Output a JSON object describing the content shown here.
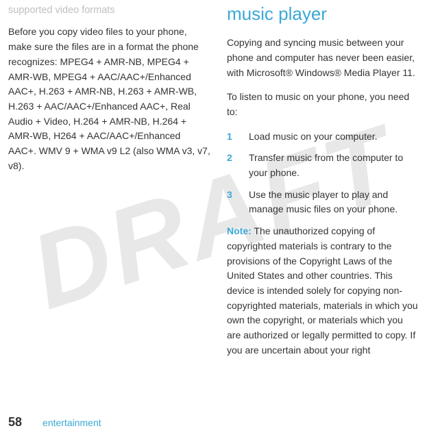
{
  "watermark": "DRAFT",
  "left": {
    "subheading": "supported video formats",
    "body": "Before you copy video files to your phone, make sure the files are in a format the phone recognizes: MPEG4 + AMR-NB, MPEG4 + AMR-WB, MPEG4 + AAC/AAC+/Enhanced AAC+, H.263 + AMR-NB, H.263 + AMR-WB, H.263 + AAC/AAC+/Enhanced AAC+, Real Audio + Video, H.264 + AMR-NB, H.264 + AMR-WB, H264 + AAC/AAC+/Enhanced AAC+. WMV 9 + WMA v9 L2 (also WMA v3, v7, v8)."
  },
  "right": {
    "heading": "music player",
    "intro": "Copying and syncing music between your phone and computer has never been easier, with Microsoft® Windows® Media Player 11.",
    "lead": "To listen to music on your phone, you need to:",
    "steps": [
      {
        "num": "1",
        "text": "Load music on your computer."
      },
      {
        "num": "2",
        "text": "Transfer music from the computer to your phone."
      },
      {
        "num": "3",
        "text": "Use the music player to play and manage music files on your phone."
      }
    ],
    "note_label": "Note:",
    "note_body": " The unauthorized copying of copyrighted materials is contrary to the provisions of the Copyright Laws of the United States and other countries. This device is intended solely for copying non-copyrighted materials, materials in which you own the copyright, or materials which you are authorized or legally permitted to copy. If you are uncertain about your right"
  },
  "footer": {
    "page": "58",
    "section": "entertainment"
  }
}
